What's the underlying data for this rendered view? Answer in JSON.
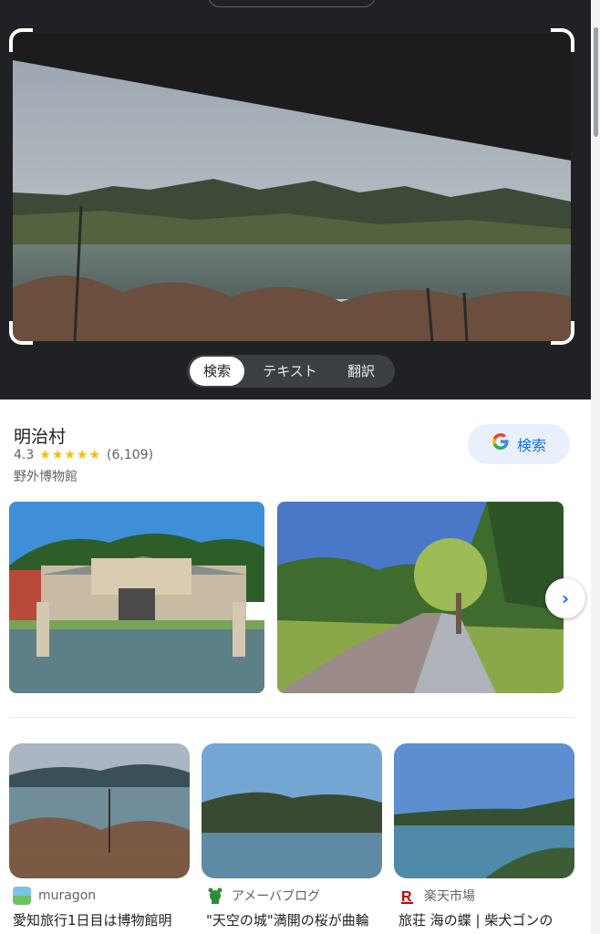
{
  "lens": {
    "modes": [
      "検索",
      "テキスト",
      "翻訳"
    ],
    "active_mode": "検索"
  },
  "result": {
    "title": "明治村",
    "rating": "4.3",
    "stars": "★★★★★",
    "reviews": "(6,109)",
    "type": "野外博物館",
    "search_button": "検索",
    "google_letter": "G",
    "next_icon": "›"
  },
  "related": [
    {
      "source": "muragon",
      "title": "愛知旅行1日目は博物館明",
      "icon": "muragon-icon"
    },
    {
      "source": "アメーバブログ",
      "title": "\"天空の城\"満開の桜が曲輪",
      "icon": "ameba-icon"
    },
    {
      "source": "楽天市場",
      "title": "旅荘 海の蝶 | 柴犬ゴンの",
      "icon": "rakuten-icon"
    }
  ],
  "colors": {
    "accent": "#1a73e8",
    "star": "#fbbc04",
    "dark_bg": "#202124"
  }
}
